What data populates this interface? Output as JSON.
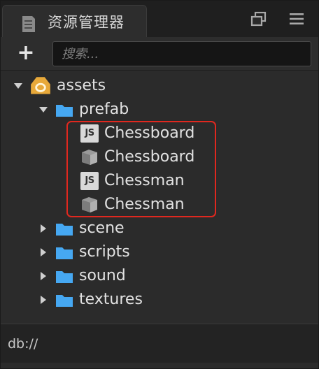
{
  "panel": {
    "title": "资源管理器",
    "icons": {
      "tab": "document-icon",
      "popout": "popout-window-icon",
      "menu": "hamburger-menu-icon"
    }
  },
  "toolbar": {
    "add_label": "+",
    "search_placeholder": "搜索..."
  },
  "tree": {
    "root": {
      "label": "assets",
      "icon": "assets-db-icon",
      "expanded": true
    },
    "prefab_folder": {
      "label": "prefab",
      "icon": "folder-icon",
      "expanded": true
    },
    "prefab_items": [
      {
        "label": "Chessboard",
        "icon": "js-file-icon",
        "badge": "JS"
      },
      {
        "label": "Chessboard",
        "icon": "prefab-icon"
      },
      {
        "label": "Chessman",
        "icon": "js-file-icon",
        "badge": "JS"
      },
      {
        "label": "Chessman",
        "icon": "prefab-icon"
      }
    ],
    "folders": [
      {
        "label": "scene",
        "icon": "folder-icon",
        "expanded": false
      },
      {
        "label": "scripts",
        "icon": "folder-icon",
        "expanded": false
      },
      {
        "label": "sound",
        "icon": "folder-icon",
        "expanded": false
      },
      {
        "label": "textures",
        "icon": "folder-icon",
        "expanded": false
      }
    ]
  },
  "footer": {
    "path": "db://"
  },
  "colors": {
    "panel_bg": "#2b2b2b",
    "folder_blue": "#46a8f2",
    "assets_gold": "#e8a93a",
    "highlight_red": "#e0281f",
    "text": "#e2e2e2"
  }
}
